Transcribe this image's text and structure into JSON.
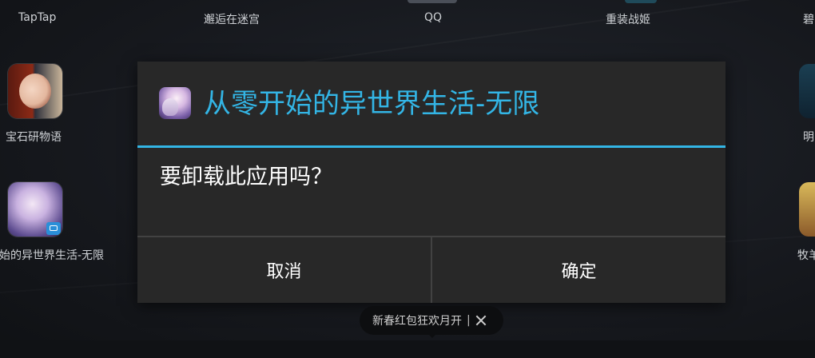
{
  "home": {
    "top_row": [
      "TapTap",
      "邂逅在迷宫",
      "QQ",
      "重装战姬",
      "碧"
    ],
    "left_apps": [
      "宝石研物语",
      "始的异世界生活-无限"
    ],
    "right_apps": [
      "明",
      "牧羊"
    ]
  },
  "dialog": {
    "title": "从零开始的异世界生活-无限",
    "message": "要卸载此应用吗？",
    "cancel_label": "取消",
    "ok_label": "确定",
    "accent_color": "#33b5e5"
  },
  "promo": {
    "text": "新春红包狂欢月开",
    "separator": "|"
  }
}
